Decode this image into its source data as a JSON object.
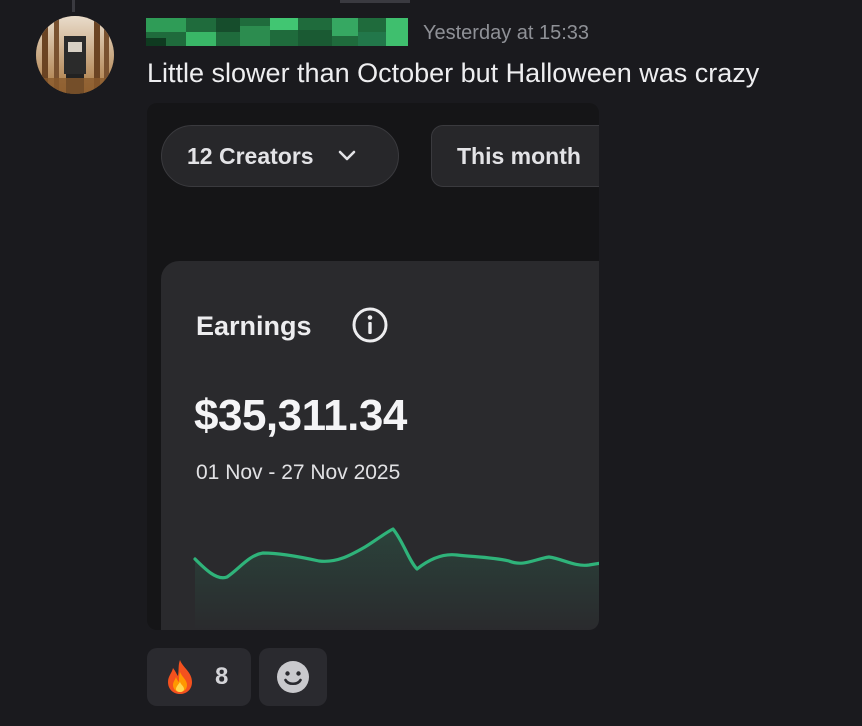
{
  "message": {
    "author_visible": false,
    "timestamp": "Yesterday at 15:33",
    "text": "Little slower than October but Halloween was crazy"
  },
  "attachment": {
    "filter_creators": "12 Creators",
    "filter_period": "This month",
    "card_title": "Earnings",
    "earnings_total": "$35,311.34",
    "date_range": "01 Nov - 27 Nov 2025",
    "accent_color": "#2fb37a"
  },
  "reactions": [
    {
      "emoji": "🔥",
      "count": "8"
    }
  ],
  "icons": {
    "chevron": "chevron-down-icon",
    "info": "info-icon",
    "add_reaction": "smiley-add-reaction-icon"
  }
}
